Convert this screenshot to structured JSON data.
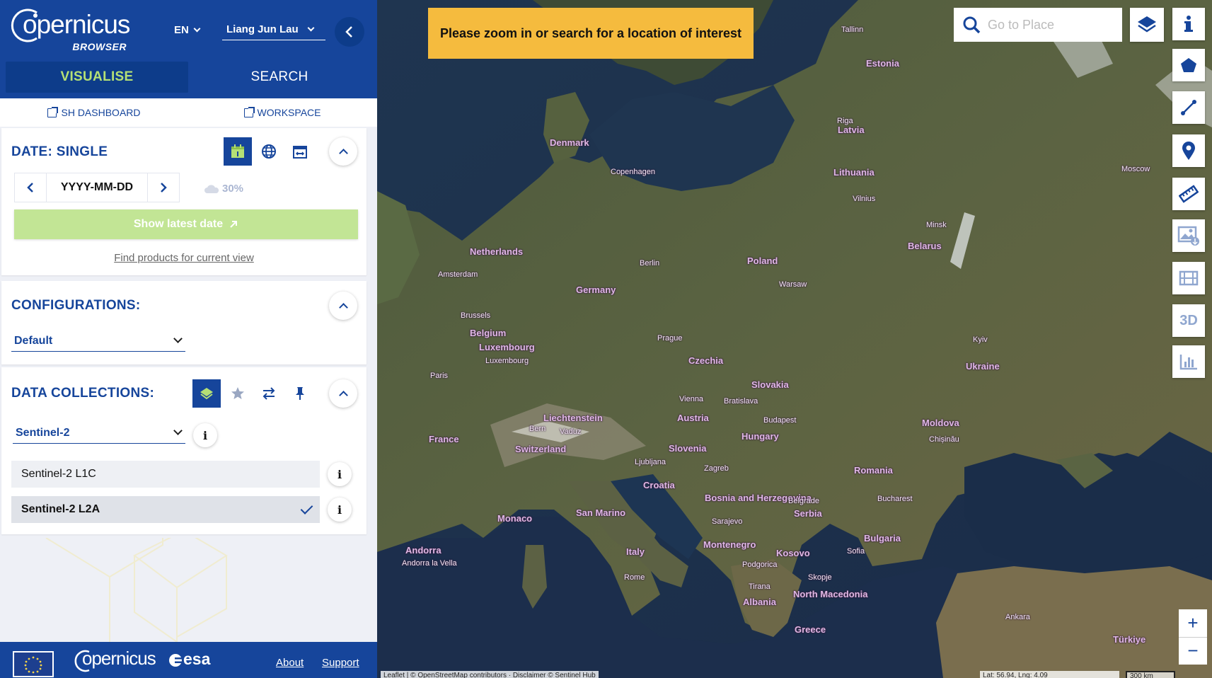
{
  "app": {
    "logo_word": "opernicus",
    "logo_c": "C",
    "logo_sub": "BROWSER",
    "language": "EN",
    "user": "Liang Jun Lau"
  },
  "tabs": [
    "VISUALISE",
    "SEARCH"
  ],
  "links": {
    "dashboard": "SH DASHBOARD",
    "workspace": "WORKSPACE"
  },
  "date_panel": {
    "title": "DATE: SINGLE",
    "date_value": "YYYY-MM-DD",
    "cloud_coverage": "30%",
    "latest_button": "Show latest date",
    "find_link": "Find products for current view"
  },
  "config_panel": {
    "title": "CONFIGURATIONS:",
    "selected": "Default"
  },
  "data_panel": {
    "title": "DATA COLLECTIONS:",
    "selected": "Sentinel-2",
    "items": [
      {
        "label": "Sentinel-2 L1C",
        "selected": false
      },
      {
        "label": "Sentinel-2 L2A",
        "selected": true
      }
    ]
  },
  "footer": {
    "copernicus": "opernicus",
    "copernicus_c": "C",
    "esa": "esa",
    "about": "About",
    "support": "Support"
  },
  "map": {
    "banner": "Please zoom in or search for a location of interest",
    "search_placeholder": "Go to Place",
    "tools": [
      "info-icon",
      "polygon-icon",
      "line-icon",
      "pin-icon",
      "ruler-icon",
      "image-download-icon",
      "timelapse-icon",
      "3d-icon",
      "histogram-icon"
    ],
    "tool_3d_label": "3D",
    "zoom_in": "+",
    "zoom_out": "−",
    "attribution": "Leaflet | © OpenStreetMap contributors · Disclaimer © Sentinel Hub",
    "coordinates": "Lat: 56.94, Lng: 4.09",
    "scale": "300 km",
    "countries": [
      "Estonia",
      "Latvia",
      "Lithuania",
      "Denmark",
      "Belarus",
      "Netherlands",
      "Poland",
      "Germany",
      "Belgium",
      "Luxembourg",
      "Czechia",
      "Ukraine",
      "Slovakia",
      "Liechtenstein",
      "Austria",
      "Moldova",
      "France",
      "Switzerland",
      "Hungary",
      "Slovenia",
      "Croatia",
      "Romania",
      "Bosnia and Herzegovina",
      "Serbia",
      "Monaco",
      "San Marino",
      "Bulgaria",
      "Montenegro",
      "Kosovo",
      "Andorra",
      "Italy",
      "North Macedonia",
      "Albania",
      "Greece",
      "Türkiye"
    ],
    "cities": [
      "Tallinn",
      "Riga",
      "Copenhagen",
      "Vilnius",
      "Minsk",
      "Moscow",
      "Amsterdam",
      "Berlin",
      "Warsaw",
      "Brussels",
      "Prague",
      "Luxembourg",
      "Kyiv",
      "Paris",
      "Vienna",
      "Bratislava",
      "Budapest",
      "Bern",
      "Vaduz",
      "Chișinău",
      "Ljubljana",
      "Zagreb",
      "Belgrade",
      "Bucharest",
      "Sarajevo",
      "Sofia",
      "Podgorica",
      "Skopje",
      "Tirana",
      "Andorra la Vella",
      "Rome",
      "Ankara"
    ]
  },
  "colors": {
    "brand_blue": "#16459b",
    "accent_green": "#b5e075",
    "banner_yellow": "#f5bb3e"
  }
}
